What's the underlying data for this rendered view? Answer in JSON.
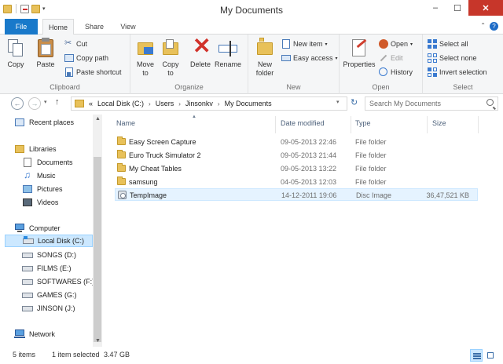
{
  "window": {
    "title": "My Documents"
  },
  "ribbon_tabs": {
    "file": "File",
    "home": "Home",
    "share": "Share",
    "view": "View"
  },
  "clipboard": {
    "copy": "Copy",
    "paste": "Paste",
    "cut": "Cut",
    "copy_path": "Copy path",
    "paste_shortcut": "Paste shortcut",
    "group": "Clipboard"
  },
  "organize": {
    "move_to": "Move to",
    "copy_to": "Copy to",
    "delete": "Delete",
    "rename": "Rename",
    "group": "Organize"
  },
  "new_group": {
    "new_folder": "New folder",
    "new_item": "New item",
    "easy_access": "Easy access",
    "group": "New"
  },
  "open_group": {
    "properties": "Properties",
    "open": "Open",
    "edit": "Edit",
    "history": "History",
    "group": "Open"
  },
  "select_group": {
    "select_all": "Select all",
    "select_none": "Select none",
    "invert_selection": "Invert selection",
    "group": "Select"
  },
  "address": {
    "prefix": "«",
    "crumbs": [
      "Local Disk (C:)",
      "Users",
      "Jinsonkv",
      "My Documents"
    ],
    "search_placeholder": "Search My Documents"
  },
  "navpane": {
    "recent_places": "Recent places",
    "libraries": "Libraries",
    "documents": "Documents",
    "music": "Music",
    "pictures": "Pictures",
    "videos": "Videos",
    "computer": "Computer",
    "local_disk": "Local Disk (C:)",
    "drives": [
      "SONGS (D:)",
      "FILMS (E:)",
      "SOFTWARES (F:)",
      "GAMES (G:)",
      "JINSON (J:)"
    ],
    "network": "Network"
  },
  "columns": {
    "name": "Name",
    "date": "Date modified",
    "type": "Type",
    "size": "Size"
  },
  "files": [
    {
      "name": "Easy Screen Capture",
      "date": "09-05-2013 22:46",
      "type": "File folder",
      "size": ""
    },
    {
      "name": "Euro Truck Simulator 2",
      "date": "09-05-2013 21:44",
      "type": "File folder",
      "size": ""
    },
    {
      "name": "My Cheat Tables",
      "date": "09-05-2013 13:22",
      "type": "File folder",
      "size": ""
    },
    {
      "name": "samsung",
      "date": "04-05-2013 12:03",
      "type": "File folder",
      "size": ""
    },
    {
      "name": "TempImage",
      "date": "14-12-2011 19:06",
      "type": "Disc Image",
      "size": "36,47,521 KB"
    }
  ],
  "status": {
    "count": "5 items",
    "selected": "1 item selected",
    "size": "3.47 GB"
  }
}
